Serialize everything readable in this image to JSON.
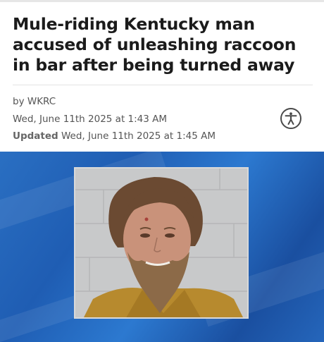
{
  "article": {
    "headline": "Mule-riding Kentucky man accused of unleashing raccoon in bar after being turned away",
    "byline": "by WKRC",
    "published": "Wed, June 11th 2025 at 1:43 AM",
    "updated_label": "Updated",
    "updated": "Wed, June 11th 2025 at 1:45 AM"
  },
  "accessibility_button": {
    "icon": "accessibility-icon"
  },
  "photo": {
    "subject": "mugshot-photo"
  },
  "colors": {
    "headline": "#1b1b1b",
    "meta_text": "#555555",
    "photo_background": "#1f5db3"
  }
}
